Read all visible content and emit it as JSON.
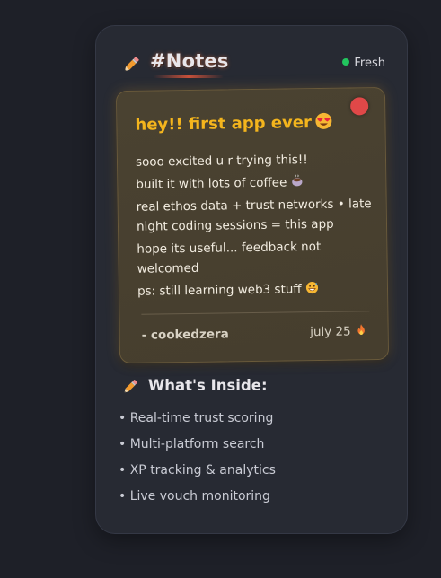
{
  "header": {
    "title": "#Notes",
    "status": "Fresh",
    "status_color": "#22c55e"
  },
  "note": {
    "title": "hey!! first app ever",
    "title_emoji": "smiling-face-with-heart-eyes-icon",
    "lines": [
      "sooo excited u r trying this!!",
      "built it with lots of coffee",
      "real ethos data + trust networks • late night coding sessions = this app",
      "hope its useful... feedback not welcomed",
      "ps: still learning web3 stuff"
    ],
    "author": "- cookedzera",
    "date": "july 25",
    "accent_color": "#f4b51d",
    "pin_color": "#e04848"
  },
  "inside": {
    "title": "What's Inside:",
    "items": [
      "• Real-time trust scoring",
      "• Multi-platform search",
      "• XP tracking & analytics",
      "• Live vouch monitoring"
    ]
  }
}
